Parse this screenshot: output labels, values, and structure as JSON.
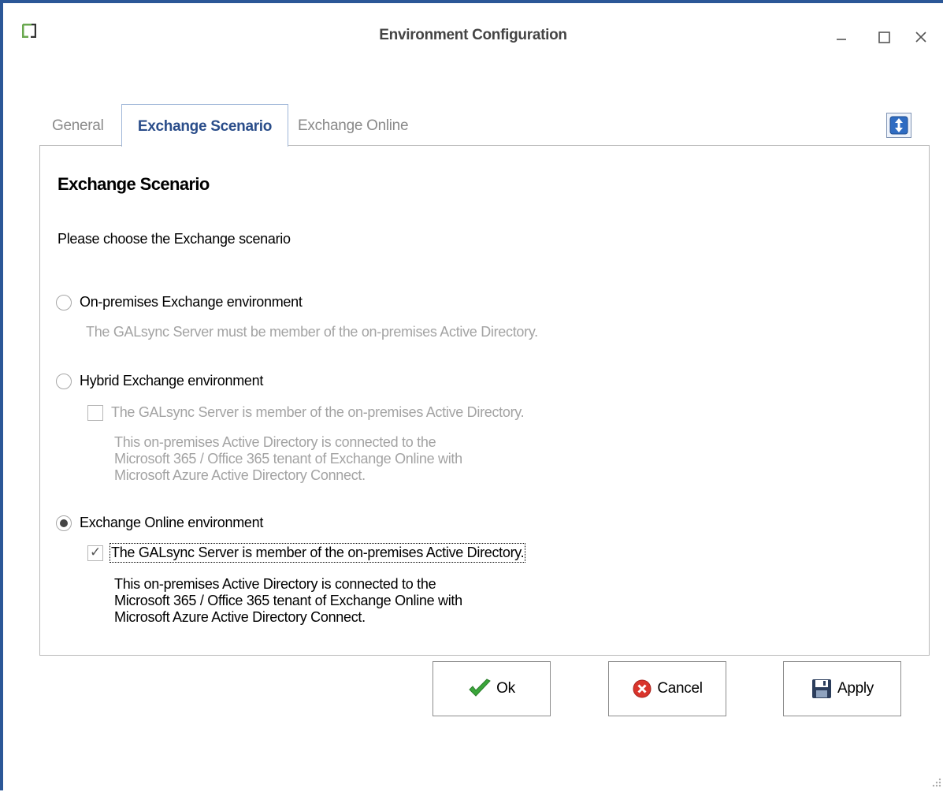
{
  "window": {
    "title": "Environment Configuration",
    "controls": {
      "minimize": "—",
      "maximize": "☐",
      "close": "✕"
    }
  },
  "tabs": {
    "items": [
      {
        "label": "General",
        "selected": false
      },
      {
        "label": "Exchange Scenario",
        "selected": true
      },
      {
        "label": "Exchange Online",
        "selected": false
      }
    ]
  },
  "panel": {
    "heading": "Exchange Scenario",
    "prompt": "Please choose the Exchange scenario",
    "options": [
      {
        "label": "On-premises Exchange environment",
        "checked": false,
        "description": "The GALsync Server must be member of the on-premises Active Directory."
      },
      {
        "label": "Hybrid Exchange environment",
        "checked": false,
        "checkbox_label": "The GALsync Server is member of the on-premises Active Directory.",
        "checkbox_checked": false,
        "description_lines": [
          "This on-premises Active Directory is connected to the",
          "Microsoft 365 / Office 365 tenant of Exchange Online with",
          "Microsoft Azure Active Directory Connect."
        ]
      },
      {
        "label": "Exchange Online environment",
        "checked": true,
        "checkbox_label": "The GALsync Server is member of the on-premises Active Directory.",
        "checkbox_checked": true,
        "description_lines": [
          "This on-premises Active Directory is connected to the",
          "Microsoft 365 / Office 365 tenant of Exchange Online with",
          "Microsoft Azure Active Directory Connect."
        ]
      }
    ]
  },
  "buttons": {
    "ok": "Ok",
    "cancel": "Cancel",
    "apply": "Apply"
  },
  "icons": {
    "app": "app-icon",
    "toggle": "expand-collapse-icon",
    "ok": "checkmark-icon",
    "cancel": "cancel-icon",
    "apply": "save-icon"
  },
  "colors": {
    "accent_border": "#2b5797",
    "active_tab_text": "#2a4d8a",
    "disabled_text": "#a3a3a3",
    "ok_green": "#3aa63a",
    "cancel_red": "#d9342b"
  }
}
